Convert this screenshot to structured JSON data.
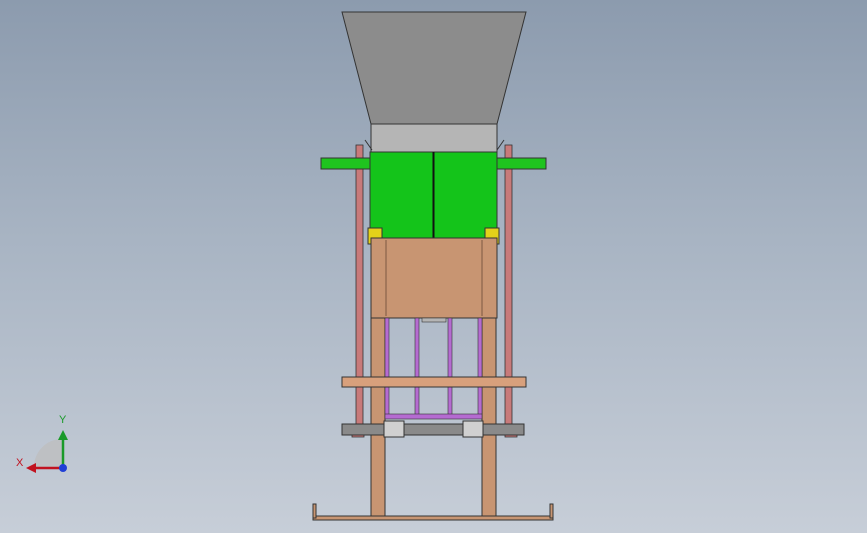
{
  "triad": {
    "x_label": "X",
    "y_label": "Y",
    "x_color": "#c1121f",
    "y_color": "#1a9a2a",
    "z_color": "#1f3fd6"
  },
  "model": {
    "colors": {
      "hopper": "#8c8c8c",
      "collar": "#b5b5b5",
      "green_block": "#14c41a",
      "green_shaft": "#1fc41f",
      "yellow": "#e3d21a",
      "box": "#c89572",
      "legs": "#c89572",
      "purple": "#b56bd1",
      "frame_side": "#c07070",
      "orange_rod": "#d8a07c",
      "gray_shaft": "#8a8a8a"
    }
  }
}
